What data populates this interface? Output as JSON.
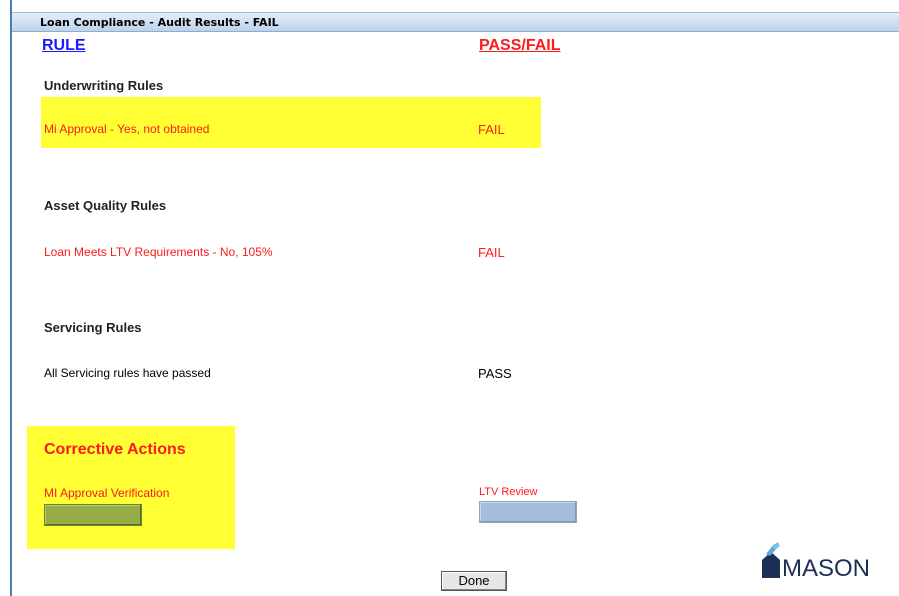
{
  "window": {
    "title": "Loan Compliance - Audit Results - FAIL"
  },
  "columns": {
    "rule": "RULE",
    "pass_fail": "PASS/FAIL"
  },
  "sections": [
    {
      "title": "Underwriting Rules",
      "rule": "Mi Approval - Yes, not obtained",
      "result": "FAIL",
      "highlighted": true
    },
    {
      "title": "Asset Quality Rules",
      "rule": "Loan Meets LTV Requirements - No, 105%",
      "result": "FAIL",
      "highlighted": false
    },
    {
      "title": "Servicing Rules",
      "rule": "All Servicing rules have passed",
      "result": "PASS",
      "highlighted": false
    }
  ],
  "corrective_actions": {
    "title": "Corrective Actions",
    "items": [
      {
        "label": "MI Approval Verification",
        "button_color": "#94ad45"
      },
      {
        "label": "LTV Review",
        "button_color": "#a2bedc"
      }
    ]
  },
  "done_label": "Done",
  "logo_text": "MASON",
  "colors": {
    "fail": "#ff1a1a",
    "link": "#1a1aff",
    "highlight": "#ffff33",
    "title_bar": "#bcd3ec"
  }
}
